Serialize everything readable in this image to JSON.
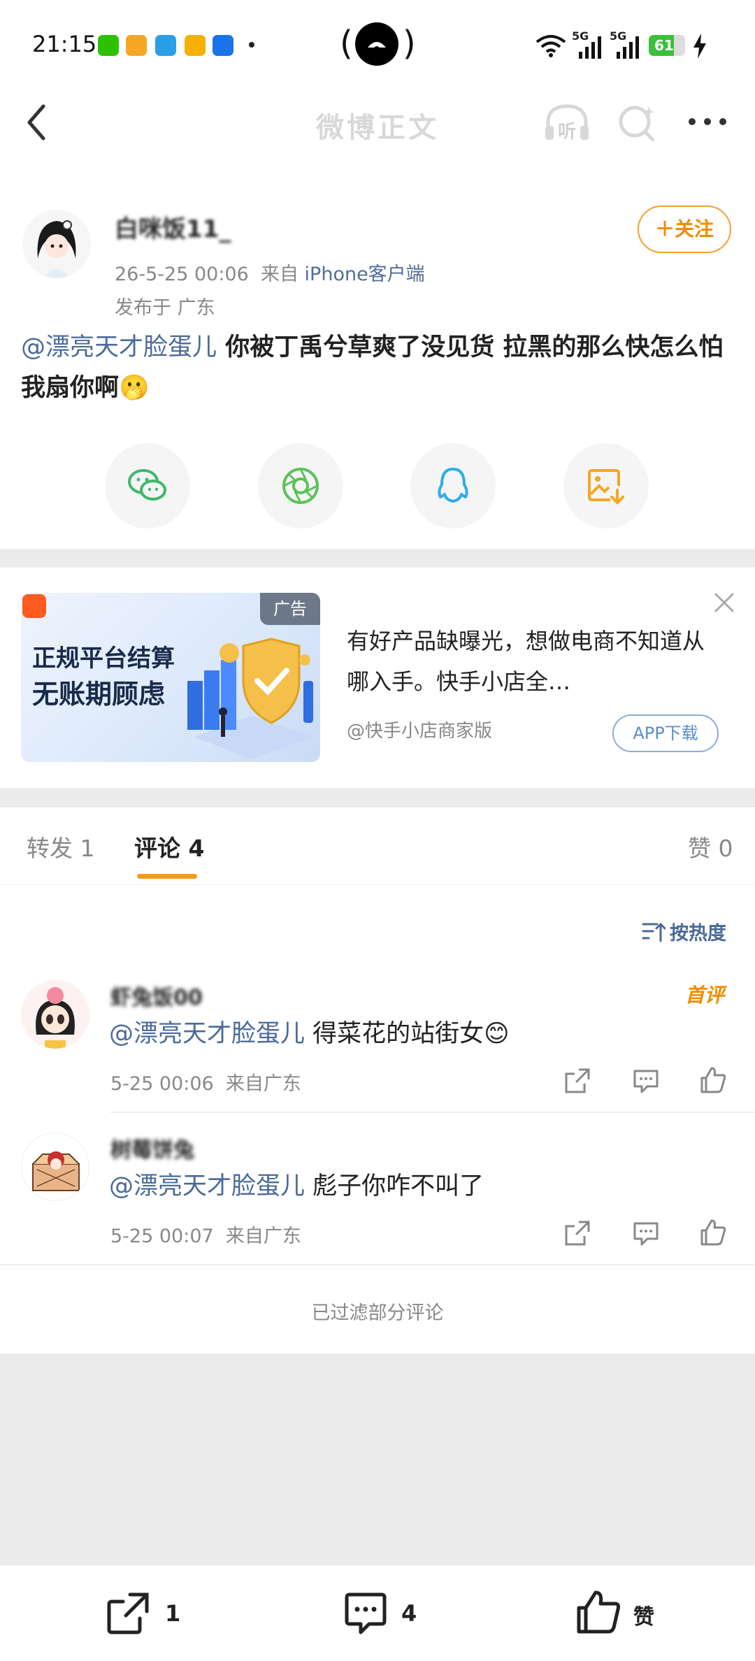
{
  "status_bar": {
    "time": "21:15",
    "battery": "61",
    "signal1": "5G",
    "signal2": "5G"
  },
  "nav": {
    "title": "微博正文",
    "listen_label": "听"
  },
  "post": {
    "username": "白咪饭11_",
    "date": "26-5-25 00:06",
    "source_prefix": "来自",
    "source": "iPhone客户端",
    "location": "发布于 广东",
    "follow_label": "＋关注",
    "mention": "@漂亮天才脸蛋儿",
    "text": " 你被丁禹兮草爽了没见货 拉黑的那么快怎么怕我扇你啊",
    "emoji": "🫢"
  },
  "share": [
    {
      "icon": "wechat-icon",
      "color": "#3fb86a"
    },
    {
      "icon": "moments-icon",
      "color": "#5cc25a"
    },
    {
      "icon": "qq-icon",
      "color": "#2eaee6"
    },
    {
      "icon": "save-image-icon",
      "color": "#f5a623"
    }
  ],
  "ad": {
    "tag": "广告",
    "slogan1": "正规平台结算",
    "slogan2": "无账期顾虑",
    "description": "有好产品缺曝光，想做电商不知道从哪入手。快手小店全…",
    "advertiser": "@快手小店商家版",
    "download_label": "APP下载"
  },
  "tabs": {
    "repost": "转发 1",
    "comment": "评论 4",
    "like": "赞 0"
  },
  "sort_label": "按热度",
  "comments": [
    {
      "name": "虾兔饭00",
      "badge": "首评",
      "mention": "@漂亮天才脸蛋儿",
      "text": " 得菜花的站街女",
      "emoji": "😊",
      "time": "5-25 00:06",
      "location": "来自广东"
    },
    {
      "name": "树莓饼兔",
      "mention": "@漂亮天才脸蛋儿",
      "text": " 彪子你咋不叫了",
      "time": "5-25 00:07",
      "location": "来自广东"
    }
  ],
  "filtered_note": "已过滤部分评论",
  "bottom": {
    "repost_count": "1",
    "comment_count": "4",
    "like_label": "赞"
  }
}
